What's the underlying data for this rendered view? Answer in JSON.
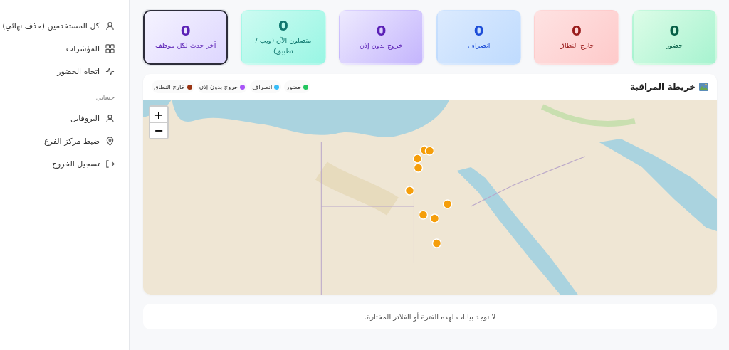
{
  "sidebar": {
    "items": [
      {
        "label": "كل المستخدمين (حذف نهائي)",
        "kind": "users"
      },
      {
        "label": "المؤشرات",
        "kind": "indicators"
      },
      {
        "label": "اتجاه الحضور",
        "kind": "trend"
      }
    ],
    "section_title": "حسابي",
    "account_items": [
      {
        "label": "البروفايل",
        "kind": "profile"
      },
      {
        "label": "ضبط مركز الفرع",
        "kind": "location"
      },
      {
        "label": "تسجيل الخروج",
        "kind": "logout"
      }
    ]
  },
  "stat_cards": [
    {
      "kind": "attendance",
      "value": "0",
      "label": "حضور",
      "selected": false
    },
    {
      "kind": "out_of_range",
      "value": "0",
      "label": "خارج النطاق",
      "selected": false
    },
    {
      "kind": "departure",
      "value": "0",
      "label": "انصراف",
      "selected": false
    },
    {
      "kind": "unauthorized_exit",
      "value": "0",
      "label": "خروج بدون إذن",
      "selected": false
    },
    {
      "kind": "online",
      "value": "0",
      "label": "متصلون الآن (ويب / تطبيق)",
      "selected": false
    },
    {
      "kind": "last_event",
      "value": "0",
      "label": "آخر حدث لكل موظف",
      "selected": true
    }
  ],
  "map_panel": {
    "title": "خريطة المراقبة",
    "legend": [
      {
        "label": "حضور",
        "color": "#22c55e"
      },
      {
        "label": "انصراف",
        "color": "#38bdf8"
      },
      {
        "label": "خروج بدون إذن",
        "color": "#a855f7"
      },
      {
        "label": "خارج النطاق",
        "color": "#9a3412"
      }
    ],
    "zoom_in": "+",
    "zoom_out": "−"
  },
  "empty_state": "لا توجد بيانات لهذه الفترة أو الفلاتر المختارة."
}
